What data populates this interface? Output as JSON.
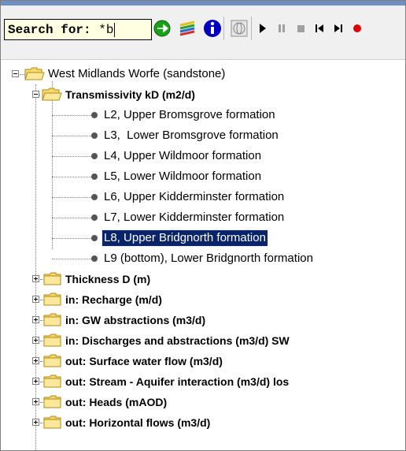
{
  "search": {
    "label": "Search for: ",
    "value": "*b"
  },
  "toolbar": {
    "buttons": [
      {
        "name": "gray-circle-icon"
      },
      {
        "name": "gray-dot-icon"
      },
      {
        "name": "hand-icon"
      },
      {
        "name": "green-circle-icon"
      },
      {
        "name": "green-arrow-icon"
      },
      {
        "name": "layers-icon"
      },
      {
        "name": "info-icon"
      },
      {
        "name": "globe-icon"
      },
      {
        "name": "play-icon"
      },
      {
        "name": "pause-icon"
      },
      {
        "name": "stop-icon"
      },
      {
        "name": "skip-back-icon"
      },
      {
        "name": "skip-forward-icon"
      },
      {
        "name": "record-icon"
      }
    ],
    "colors": {
      "play": "#000000",
      "pause": "#a0a0a0",
      "record": "#e00000",
      "green": "#1aa11a",
      "info": "#0000c0"
    }
  },
  "tree": {
    "root": {
      "label": "West Midlands Worfe (sandstone)"
    },
    "group_open": {
      "label": "Transmissivity kD (m2/d)"
    },
    "layers": [
      {
        "label": "L2, Upper Bromsgrove formation"
      },
      {
        "label": "L3,  Lower Bromsgrove formation"
      },
      {
        "label": "L4, Upper Wildmoor formation"
      },
      {
        "label": "L5, Lower Wildmoor formation"
      },
      {
        "label": "L6, Upper Kidderminster formation"
      },
      {
        "label": "L7, Lower Kidderminster formation"
      },
      {
        "label": "L8, Upper Bridgnorth formation",
        "selected": true
      },
      {
        "label": "L9 (bottom), Lower Bridgnorth formation"
      }
    ],
    "collapsed_groups": [
      {
        "label": "Thickness D (m)"
      },
      {
        "label": "in: Recharge (m/d)"
      },
      {
        "label": "in: GW abstractions (m3/d)"
      },
      {
        "label": "in: Discharges and abstractions (m3/d) SW"
      },
      {
        "label": "out: Surface water flow (m3/d)"
      },
      {
        "label": "out: Stream - Aquifer interaction (m3/d) los"
      },
      {
        "label": "out: Heads (mAOD)"
      },
      {
        "label": "out: Horizontal flows (m3/d)"
      }
    ],
    "colors": {
      "folder": "#f7d96b",
      "folder_edge": "#b08a1a",
      "selected_bg": "#0a246a"
    }
  }
}
